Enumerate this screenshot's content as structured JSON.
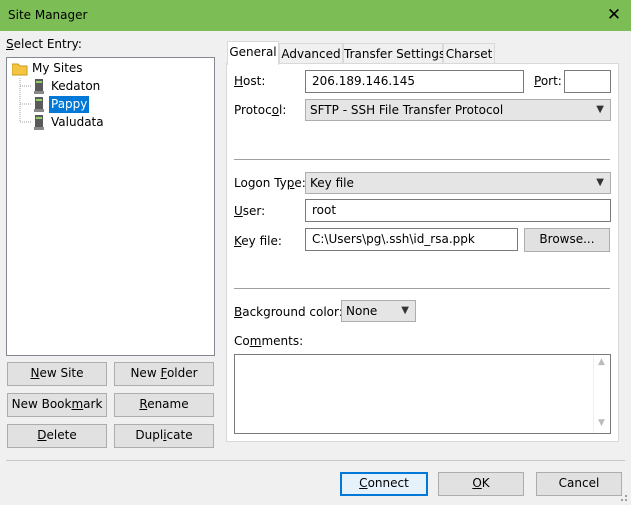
{
  "window": {
    "title": "Site Manager",
    "close_glyph": "✕",
    "accent_color": "#7cbd56"
  },
  "select_entry": {
    "label_key": "S",
    "label_rest": "elect Entry:"
  },
  "tree": {
    "root_label": "My Sites",
    "sites": [
      {
        "label": "Kedaton"
      },
      {
        "label": "Pappy",
        "selected": true
      },
      {
        "label": "Valudata"
      }
    ]
  },
  "left_buttons": {
    "new_site": {
      "key": "N",
      "rest": "ew Site"
    },
    "new_folder": {
      "pre": "New ",
      "key": "F",
      "rest": "older"
    },
    "new_bookmark": {
      "pre": "New Book",
      "key": "m",
      "rest": "ark"
    },
    "rename": {
      "key": "R",
      "rest": "ename"
    },
    "delete": {
      "key": "D",
      "rest": "elete"
    },
    "duplicate": {
      "pre": "Dupl",
      "key": "i",
      "rest": "cate"
    }
  },
  "tabs": [
    {
      "label": "General",
      "active": true
    },
    {
      "label": "Advanced"
    },
    {
      "label": "Transfer Settings"
    },
    {
      "label": "Charset"
    }
  ],
  "general": {
    "host_label": {
      "key": "H",
      "rest": "ost:"
    },
    "host_value": "206.189.146.145",
    "port_label": {
      "key": "P",
      "rest": "ort:"
    },
    "port_value": "",
    "protocol_label": {
      "pre": "Protoc",
      "key": "o",
      "rest": "l:"
    },
    "protocol_value": "SFTP - SSH File Transfer Protocol",
    "logon_label": {
      "pre": "Logon Ty",
      "key": "p",
      "rest": "e:"
    },
    "logon_value": "Key file",
    "user_label": {
      "key": "U",
      "rest": "ser:"
    },
    "user_value": "root",
    "keyfile_label": {
      "pre": "",
      "key": "K",
      "rest": "ey file:"
    },
    "keyfile_value": "C:\\Users\\pg\\.ssh\\id_rsa.ppk",
    "browse_label": "Browse...",
    "bgcolor_label": {
      "key": "B",
      "rest": "ackground color:"
    },
    "bgcolor_value": "None",
    "comments_label": {
      "pre": "Co",
      "key": "m",
      "rest": "ments:"
    },
    "comments_value": ""
  },
  "footer": {
    "connect": {
      "key": "C",
      "rest": "onnect"
    },
    "ok": {
      "key": "O",
      "rest": "K"
    },
    "cancel": "Cancel"
  }
}
